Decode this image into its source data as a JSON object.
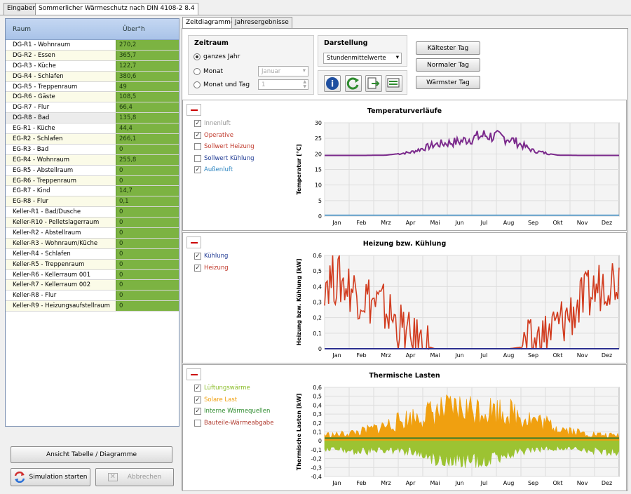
{
  "tabs_top": [
    {
      "label": "Eingaben"
    },
    {
      "label": "Sommerlicher Wärmeschutz nach DIN 4108-2 8.4"
    }
  ],
  "table": {
    "col_room": "Raum",
    "col_val": "Über°h",
    "rows": [
      {
        "room": "DG-R1 - Wohnraum",
        "val": "270,2"
      },
      {
        "room": "DG-R2 - Essen",
        "val": "365,7"
      },
      {
        "room": "DG-R3 - Küche",
        "val": "122,7"
      },
      {
        "room": "DG-R4 - Schlafen",
        "val": "380,6"
      },
      {
        "room": "DG-R5 - Treppenraum",
        "val": "49"
      },
      {
        "room": "DG-R6 - Gäste",
        "val": "108,5"
      },
      {
        "room": "DG-R7 - Flur",
        "val": "66,4"
      },
      {
        "room": "DG-R8 - Bad",
        "val": "135,8"
      },
      {
        "room": "EG-R1 - Küche",
        "val": "44,4"
      },
      {
        "room": "EG-R2 - Schlafen",
        "val": "266,1"
      },
      {
        "room": "EG-R3 - Bad",
        "val": "0"
      },
      {
        "room": "EG-R4 - Wohnraum",
        "val": "255,8"
      },
      {
        "room": "EG-R5 - Abstellraum",
        "val": "0"
      },
      {
        "room": "EG-R6 - Treppenraum",
        "val": "0"
      },
      {
        "room": "EG-R7 - Kind",
        "val": "14,7"
      },
      {
        "room": "EG-R8 - Flur",
        "val": "0,1"
      },
      {
        "room": "Keller-R1 - Bad/Dusche",
        "val": "0"
      },
      {
        "room": "Keller-R10 - Pelletslagerraum",
        "val": "0"
      },
      {
        "room": "Keller-R2 - Abstellraum",
        "val": "0"
      },
      {
        "room": "Keller-R3 - Wohnraum/Küche",
        "val": "0"
      },
      {
        "room": "Keller-R4 - Schlafen",
        "val": "0"
      },
      {
        "room": "Keller-R5 - Treppenraum",
        "val": "0"
      },
      {
        "room": "Keller-R6 - Kellerraum 001",
        "val": "0"
      },
      {
        "room": "Keller-R7 - Kellerraum 002",
        "val": "0"
      },
      {
        "room": "Keller-R8 - Flur",
        "val": "0"
      },
      {
        "room": "Keller-R9 - Heizungsaufstellraum",
        "val": "0"
      }
    ]
  },
  "buttons": {
    "toggle_view": "Ansicht Tabelle / Diagramme",
    "start_sim": "Simulation starten",
    "cancel": "Abbrechen"
  },
  "right_tabs": [
    {
      "label": "Zeitdiagramme"
    },
    {
      "label": "Jahresergebnisse"
    }
  ],
  "zeitraum": {
    "title": "Zeitraum",
    "opt_year": "ganzes Jahr",
    "opt_month": "Monat",
    "opt_day": "Monat und Tag",
    "month_value": "Januar",
    "day_value": "1"
  },
  "darstellung": {
    "title": "Darstellung",
    "value": "Stundenmittelwerte"
  },
  "daybuttons": {
    "coldest": "Kältester Tag",
    "normal": "Normaler Tag",
    "warmest": "Wärmster Tag"
  },
  "months": [
    "Jan",
    "Feb",
    "Mrz",
    "Apr",
    "Mai",
    "Jun",
    "Jul",
    "Aug",
    "Sep",
    "Okt",
    "Nov",
    "Dez"
  ],
  "chart_data": [
    {
      "type": "line",
      "title": "Temperaturverläufe",
      "ylabel": "Temperatur [°C]",
      "ylim": [
        0,
        30
      ],
      "yticks": [
        "30",
        "25",
        "20",
        "15",
        "10",
        "5",
        "0"
      ],
      "legend": [
        {
          "name": "Innenluft",
          "checked": true,
          "color": "#999999"
        },
        {
          "name": "Operative",
          "checked": true,
          "color": "#c0392b"
        },
        {
          "name": "Sollwert Heizung",
          "checked": false,
          "color": "#c0392b"
        },
        {
          "name": "Sollwert Kühlung",
          "checked": false,
          "color": "#1f3a93"
        },
        {
          "name": "Außenluft",
          "checked": true,
          "color": "#2e86c1"
        }
      ],
      "series": [
        {
          "name": "Operative",
          "color": "#7b2a8c",
          "monthly": [
            19.5,
            19.5,
            19.6,
            20.5,
            23,
            24,
            26,
            25,
            21,
            19.6,
            19.5,
            19.5
          ]
        }
      ]
    },
    {
      "type": "line",
      "title": "Heizung bzw. Kühlung",
      "ylabel": "Heizung bzw. Kühlung [kW]",
      "ylim": [
        0,
        0.6
      ],
      "yticks": [
        "0,6",
        "0,5",
        "0,4",
        "0,3",
        "0,2",
        "0,1",
        "0"
      ],
      "legend": [
        {
          "name": "Kühlung",
          "checked": true,
          "color": "#1f3a93"
        },
        {
          "name": "Heizung",
          "checked": true,
          "color": "#c0392b"
        }
      ],
      "series": [
        {
          "name": "Heizung",
          "color": "#d13b1e",
          "monthly": [
            0.45,
            0.35,
            0.25,
            0.05,
            0,
            0,
            0,
            0,
            0.02,
            0.15,
            0.3,
            0.45
          ]
        },
        {
          "name": "Kühlung",
          "color": "#2b2f8f",
          "monthly": [
            0,
            0,
            0,
            0,
            0,
            0,
            0,
            0,
            0,
            0,
            0,
            0
          ]
        }
      ]
    },
    {
      "type": "area",
      "title": "Thermische Lasten",
      "ylabel": "Thermische Lasten [kW]",
      "ylim": [
        -0.4,
        0.6
      ],
      "yticks": [
        "0,6",
        "0,5",
        "0,4",
        "0,3",
        "0,2",
        "0,1",
        "0",
        "-0,1",
        "-0,2",
        "-0,3",
        "-0,4"
      ],
      "legend": [
        {
          "name": "Lüftungswärme",
          "checked": true,
          "color": "#8bbd2a"
        },
        {
          "name": "Solare Last",
          "checked": true,
          "color": "#f0a010"
        },
        {
          "name": "Interne Wärmequellen",
          "checked": true,
          "color": "#2e8b2e"
        },
        {
          "name": "Bauteile-Wärmeabgabe",
          "checked": false,
          "color": "#b03a2e"
        }
      ],
      "series": [
        {
          "name": "Solare Last",
          "color": "#f0a010",
          "monthly": [
            0.08,
            0.12,
            0.2,
            0.3,
            0.38,
            0.42,
            0.42,
            0.38,
            0.28,
            0.18,
            0.1,
            0.07
          ]
        },
        {
          "name": "Lüftungswärme",
          "color": "#9cc332",
          "monthly": [
            -0.1,
            -0.12,
            -0.1,
            -0.12,
            -0.2,
            -0.22,
            -0.22,
            -0.15,
            -0.1,
            -0.08,
            -0.1,
            -0.12
          ]
        },
        {
          "name": "Interne Wärmequellen",
          "color": "#3b7d2a",
          "monthly": [
            0.03,
            0.03,
            0.03,
            0.03,
            0.03,
            0.03,
            0.03,
            0.03,
            0.03,
            0.03,
            0.03,
            0.03
          ]
        }
      ]
    }
  ]
}
